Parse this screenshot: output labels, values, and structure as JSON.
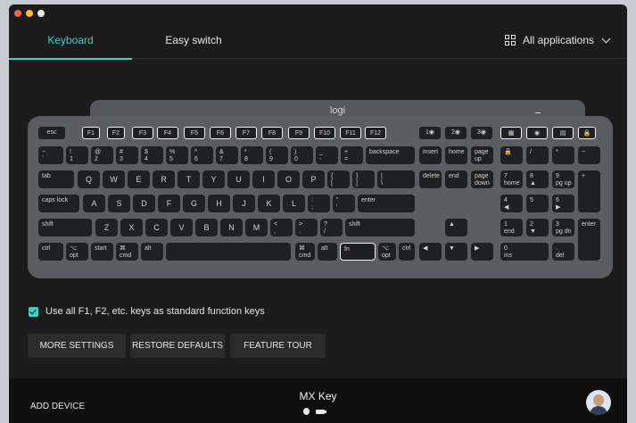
{
  "tabs": {
    "keyboard": "Keyboard",
    "easy_switch": "Easy switch"
  },
  "apps_menu": {
    "label": "All applications",
    "icon": "grid-icon"
  },
  "keyboard": {
    "logo": "logi",
    "keys": {
      "esc": "esc",
      "f1": "F1",
      "f2": "F2",
      "f3": "F3",
      "f4": "F4",
      "f5": "F5",
      "f6": "F6",
      "f7": "F7",
      "f8": "F8",
      "f9": "F9",
      "f10": "F10",
      "f11": "F11",
      "f12": "F12",
      "es1": "1◉",
      "es2": "2◉",
      "es3": "3◉",
      "calc": "▦",
      "cam": "◉",
      "menu": "▤",
      "lock": "🔒",
      "grave": "~\n`",
      "n1": "!\n1",
      "n2": "@\n2",
      "n3": "#\n3",
      "n4": "$\n4",
      "n5": "%\n5",
      "n6": "^\n6",
      "n7": "&\n7",
      "n8": "*\n8",
      "n9": "(\n9",
      "n0": ")\n0",
      "minus": "_\n-",
      "equal": "+\n=",
      "backspace": "backspace",
      "insert": "insert",
      "home": "home",
      "pgup": "page\nup",
      "numlock": "🔒",
      "kpslash": "/",
      "kpstar": "*",
      "kpminus": "−",
      "tab": "tab",
      "q": "Q",
      "w": "W",
      "e": "E",
      "r": "R",
      "t": "T",
      "y": "Y",
      "u": "U",
      "i": "I",
      "o": "O",
      "p": "P",
      "lbrace": "{\n[",
      "rbrace": "}\n]",
      "pipe": "|\n\\",
      "delete": "delete",
      "end": "end",
      "pgdn": "page\ndown",
      "kp7": "7\nhome",
      "kp8": "8\n▲",
      "kp9": "9\npg up",
      "kpplus": "+",
      "caps": "caps lock",
      "a": "A",
      "s": "S",
      "d": "D",
      "f": "F",
      "g": "G",
      "h": "H",
      "j": "J",
      "k": "K",
      "l": "L",
      "semi": ":\n;",
      "quote": "\"\n'",
      "enter": "enter",
      "kp4": "4\n◀",
      "kp5": "5",
      "kp6": "6\n▶",
      "lshift": "shift",
      "z": "Z",
      "x": "X",
      "c": "C",
      "v": "V",
      "b": "B",
      "n": "N",
      "m": "M",
      "comma": "<\n,",
      "period": ">\n.",
      "slash": "?\n/",
      "rshift": "shift",
      "up": "▲",
      "kp1": "1\nend",
      "kp2": "2\n▼",
      "kp3": "3\npg dn",
      "kpenter": "enter",
      "lctrl": "ctrl",
      "lopt": "⌥\nopt",
      "start": "start",
      "lcmd": "⌘\ncmd",
      "alt": "alt",
      "space": "",
      "rcmd": "⌘\ncmd",
      "ralt": "alt",
      "fnkey": "fn",
      "ropt": "⌥\nopt",
      "rctrl": "ctrl",
      "left": "◀",
      "down": "▼",
      "right": "▶",
      "kp0": "0\nins",
      "kpdot": ".\ndel"
    }
  },
  "setting": {
    "label": "Use all F1, F2, etc. keys as standard function keys",
    "checked": true
  },
  "buttons": {
    "more": "MORE SETTINGS",
    "restore": "RESTORE DEFAULTS",
    "tour": "FEATURE TOUR"
  },
  "footer": {
    "add_device": "ADD DEVICE",
    "device_name": "MX Key"
  },
  "colors": {
    "accent": "#3fd2c3",
    "background": "#1c1c1c",
    "key": "#1f2022",
    "keyboard_body": "#5b5d60"
  }
}
